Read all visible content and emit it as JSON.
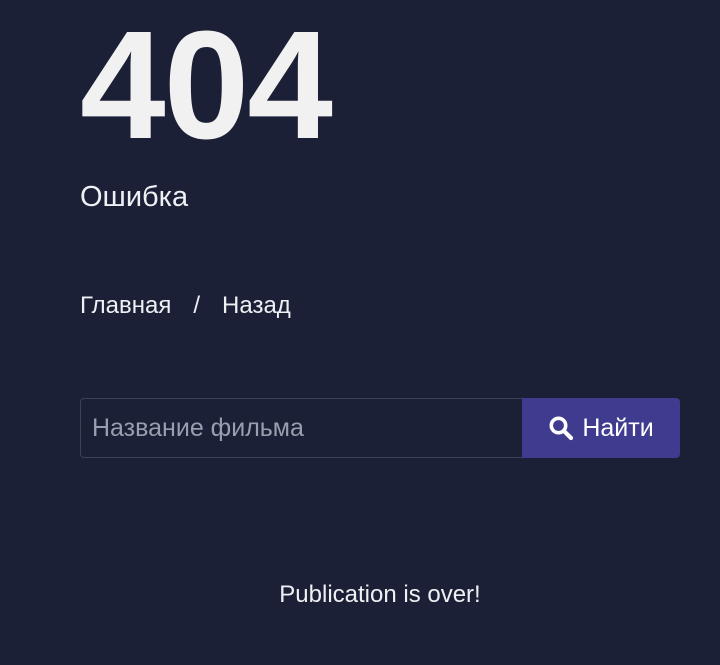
{
  "error": {
    "code": "404",
    "label": "Ошибка"
  },
  "breadcrumb": {
    "home": "Главная",
    "separator": "/",
    "back": "Назад"
  },
  "search": {
    "placeholder": "Название фильма",
    "value": "",
    "button_label": "Найти",
    "button_icon": "search-icon"
  },
  "footer": {
    "note": "Publication is over!"
  },
  "colors": {
    "background": "#1b2036",
    "button": "#3f3b8f",
    "text": "#eef0f4"
  }
}
